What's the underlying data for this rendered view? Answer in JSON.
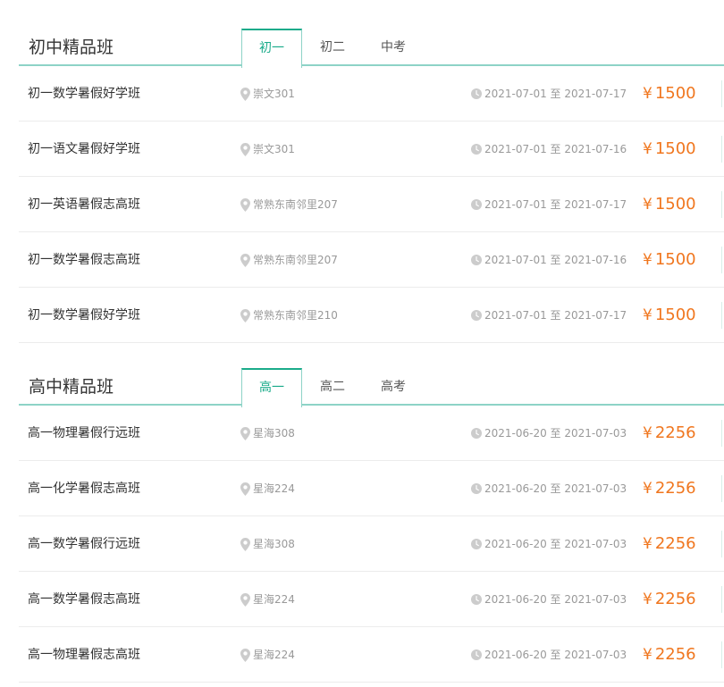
{
  "sections": [
    {
      "title": "初中精品班",
      "tabs": [
        {
          "label": "初一",
          "active": true
        },
        {
          "label": "初二",
          "active": false
        },
        {
          "label": "中考",
          "active": false
        }
      ],
      "courses": [
        {
          "name": "初一数学暑假好学班",
          "location": "崇文301",
          "dates": "2021-07-01 至 2021-07-17",
          "price": "1500"
        },
        {
          "name": "初一语文暑假好学班",
          "location": "崇文301",
          "dates": "2021-07-01 至 2021-07-16",
          "price": "1500"
        },
        {
          "name": "初一英语暑假志高班",
          "location": "常熟东南邻里207",
          "dates": "2021-07-01 至 2021-07-17",
          "price": "1500"
        },
        {
          "name": "初一数学暑假志高班",
          "location": "常熟东南邻里207",
          "dates": "2021-07-01 至 2021-07-16",
          "price": "1500"
        },
        {
          "name": "初一数学暑假好学班",
          "location": "常熟东南邻里210",
          "dates": "2021-07-01 至 2021-07-17",
          "price": "1500"
        }
      ]
    },
    {
      "title": "高中精品班",
      "tabs": [
        {
          "label": "高一",
          "active": true
        },
        {
          "label": "高二",
          "active": false
        },
        {
          "label": "高考",
          "active": false
        }
      ],
      "courses": [
        {
          "name": "高一物理暑假行远班",
          "location": "星海308",
          "dates": "2021-06-20 至 2021-07-03",
          "price": "2256"
        },
        {
          "name": "高一化学暑假志高班",
          "location": "星海224",
          "dates": "2021-06-20 至 2021-07-03",
          "price": "2256"
        },
        {
          "name": "高一数学暑假行远班",
          "location": "星海308",
          "dates": "2021-06-20 至 2021-07-03",
          "price": "2256"
        },
        {
          "name": "高一数学暑假志高班",
          "location": "星海224",
          "dates": "2021-06-20 至 2021-07-03",
          "price": "2256"
        },
        {
          "name": "高一物理暑假志高班",
          "location": "星海224",
          "dates": "2021-06-20 至 2021-07-03",
          "price": "2256"
        }
      ]
    }
  ],
  "currency_symbol": "¥",
  "icons": {
    "location": "map-pin-icon",
    "time": "clock-icon"
  },
  "colors": {
    "accent": "#1aab8a",
    "divider": "#8dd3c7",
    "price": "#f0761e",
    "muted_text": "#999999",
    "icon": "#cccccc"
  }
}
